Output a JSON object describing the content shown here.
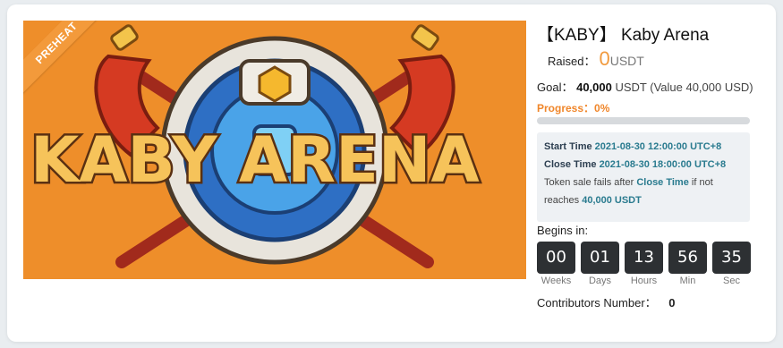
{
  "ribbon": "PREHEAT",
  "logo_text": "KABY ARENA",
  "title": {
    "symbol": "【KABY】",
    "name": "Kaby Arena"
  },
  "raised": {
    "label": "Raised：",
    "value": "0",
    "unit": "USDT"
  },
  "goal": {
    "label": "Goal：",
    "amount": "40,000",
    "detail": "USDT (Value 40,000 USD)"
  },
  "progress": {
    "label": "Progress：0%",
    "percent": 0
  },
  "times": {
    "start_label": "Start Time",
    "start_value": "2021-08-30 12:00:00 UTC+8",
    "close_label": "Close Time",
    "close_value": "2021-08-30 18:00:00 UTC+8",
    "note_prefix": "Token sale fails after",
    "note_close": "Close Time",
    "note_mid": "if not reaches",
    "note_amount": "40,000 USDT"
  },
  "begins_label": "Begins in:",
  "countdown": [
    {
      "value": "00",
      "label": "Weeks"
    },
    {
      "value": "01",
      "label": "Days"
    },
    {
      "value": "13",
      "label": "Hours"
    },
    {
      "value": "56",
      "label": "Min"
    },
    {
      "value": "35",
      "label": "Sec"
    }
  ],
  "contributors": {
    "label": "Contributors Number：",
    "value": "0"
  },
  "colors": {
    "accent": "#f0862a",
    "banner_bg": "#ee8e2a",
    "countdown_bg": "#2d3033",
    "link": "#2a7b8f"
  }
}
